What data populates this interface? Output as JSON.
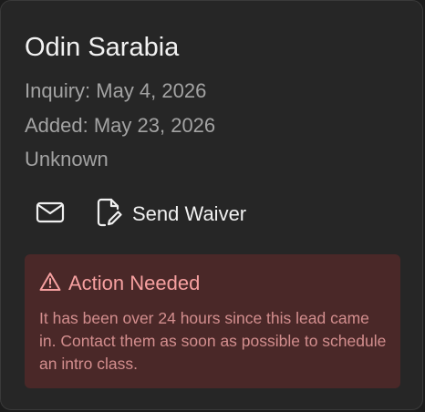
{
  "lead": {
    "name": "Odin Sarabia",
    "inquiry": "Inquiry: May 4, 2026",
    "added": "Added: May 23, 2026",
    "status": "Unknown"
  },
  "actions": {
    "email_icon": "mail-icon",
    "waiver_icon": "document-signature-icon",
    "waiver_label": "Send Waiver"
  },
  "alert": {
    "icon": "warning-triangle-icon",
    "title": "Action Needed",
    "message": "It has been over 24 hours since this lead came in. Contact them as soon as possible to schedule an intro class."
  },
  "colors": {
    "card_background": "#262626",
    "alert_background": "#4a2828",
    "alert_text": "#f6a0a0"
  }
}
